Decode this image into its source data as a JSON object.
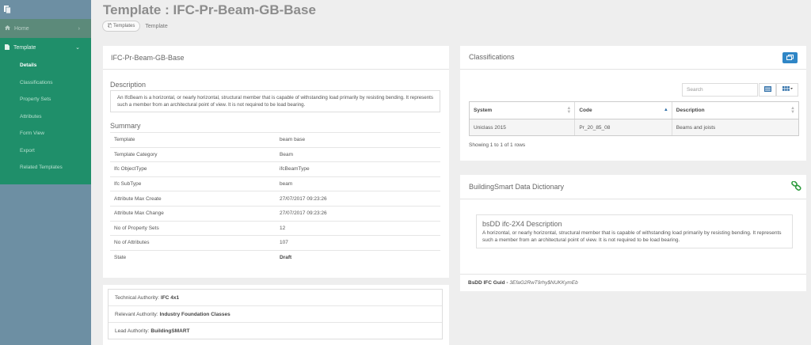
{
  "page": {
    "title": "Template : IFC-Pr-Beam-GB-Base"
  },
  "breadcrumb": {
    "templates_label": "Templates",
    "current": "Template"
  },
  "sidebar": {
    "home_label": "Home",
    "template_label": "Template",
    "items": [
      {
        "label": "Details",
        "active": true
      },
      {
        "label": "Classifications",
        "active": false
      },
      {
        "label": "Property Sets",
        "active": false
      },
      {
        "label": "Attributes",
        "active": false
      },
      {
        "label": "Form View",
        "active": false
      },
      {
        "label": "Export",
        "active": false
      },
      {
        "label": "Related Templates",
        "active": false
      }
    ]
  },
  "details": {
    "heading": "IFC-Pr-Beam-GB-Base",
    "description_heading": "Description",
    "description_text": "An IfcBeam is a horizontal, or nearly horizontal, structural member that is capable of withstanding load primarily by resisting bending. It represents such a member from an architectural point of view. It is not required to be load bearing.",
    "summary_heading": "Summary",
    "summary": [
      {
        "key": "Template",
        "value": "beam base"
      },
      {
        "key": "Template Category",
        "value": "Beam"
      },
      {
        "key": "Ifc ObjectType",
        "value": "ifcBeamType"
      },
      {
        "key": "Ifc SubType",
        "value": "beam"
      },
      {
        "key": "Attribute Max Create",
        "value": "27/07/2017 09:23:26"
      },
      {
        "key": "Attribute Max Change",
        "value": "27/07/2017 09:23:26"
      },
      {
        "key": "No of Property Sets",
        "value": "12"
      },
      {
        "key": "No of Attributes",
        "value": "107"
      },
      {
        "key": "State",
        "value": "Draft"
      }
    ]
  },
  "authorities": [
    {
      "label": "Technical Authority:",
      "value": "IFC 4x1"
    },
    {
      "label": "Relevant Authority:",
      "value": "Industry Foundation Classes"
    },
    {
      "label": "Lead Authority:",
      "value": "BuildingSMART"
    }
  ],
  "classifications": {
    "heading": "Classifications",
    "search_placeholder": "Search",
    "columns": [
      "System",
      "Code",
      "Description"
    ],
    "rows": [
      [
        "Uniclass 2015",
        "Pr_20_85_08",
        "Beams and joists"
      ]
    ],
    "row_info": "Showing 1 to 1 of 1 rows"
  },
  "bsdd": {
    "heading": "BuildingSmart Data Dictionary",
    "box_title": "bsDD ifc-2X4 Description",
    "box_text": "A horizontal, or nearly horizontal, structural member that is capable of withstanding load primarily by resisting bending. It represents such a member from an architectural point of view. It is not required to be load bearing.",
    "guid_label": "BsDD IFC Guid -",
    "guid_value": "3EfaG2RwT9rhy$NUKKymEb"
  },
  "colors": {
    "sidebar": "#6d8fa3",
    "sidebar_active_group": "#1f8f6a",
    "accent_button": "#2f86c6",
    "link_icon": "#2e9b3e"
  },
  "icons": {
    "logo": "document-icon",
    "home": "home-icon",
    "template": "file-icon",
    "popout": "window-restore-icon",
    "list_view": "list-icon",
    "column_toggle": "grid-icon",
    "link": "chain-link-icon"
  }
}
